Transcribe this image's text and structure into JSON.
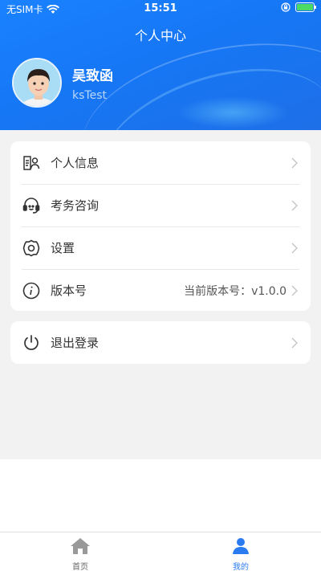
{
  "status_bar": {
    "carrier": "无SIM卡",
    "time": "15:51"
  },
  "header": {
    "title": "个人中心"
  },
  "profile": {
    "name": "吴致函",
    "account": "ksTest"
  },
  "menu": {
    "personal_info": "个人信息",
    "consult": "考务咨询",
    "settings": "设置",
    "version_label": "版本号",
    "version_value": "当前版本号：v1.0.0",
    "logout": "退出登录"
  },
  "tabbar": {
    "home": "首页",
    "mine": "我的"
  },
  "colors": {
    "header_blue": "#1677f5",
    "accent": "#2a7bf0",
    "battery_green": "#4cd964"
  }
}
